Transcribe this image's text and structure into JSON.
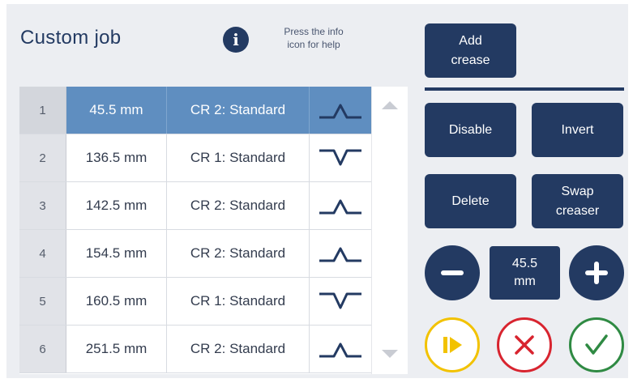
{
  "header": {
    "title": "Custom job",
    "info_text_line1": "Press the info",
    "info_text_line2": "icon for help"
  },
  "buttons": {
    "add_line1": "Add",
    "add_line2": "crease",
    "disable": "Disable",
    "invert": "Invert",
    "delete": "Delete",
    "swap_line1": "Swap",
    "swap_line2": "creaser"
  },
  "adjust": {
    "value": "45.5",
    "unit": "mm"
  },
  "creases": [
    {
      "num": "1",
      "position": "45.5 mm",
      "creaser": "CR 2: Standard",
      "shape": "up",
      "selected": true
    },
    {
      "num": "2",
      "position": "136.5 mm",
      "creaser": "CR 1: Standard",
      "shape": "down",
      "selected": false
    },
    {
      "num": "3",
      "position": "142.5 mm",
      "creaser": "CR 2: Standard",
      "shape": "up",
      "selected": false
    },
    {
      "num": "4",
      "position": "154.5 mm",
      "creaser": "CR 2: Standard",
      "shape": "up",
      "selected": false
    },
    {
      "num": "5",
      "position": "160.5 mm",
      "creaser": "CR 1: Standard",
      "shape": "down",
      "selected": false
    },
    {
      "num": "6",
      "position": "251.5 mm",
      "creaser": "CR 2: Standard",
      "shape": "up",
      "selected": false
    }
  ],
  "colors": {
    "navy": "#233a62",
    "selected_row": "#5f8ec0",
    "play": "#f2c200",
    "cancel": "#d8242f",
    "confirm": "#2f8a43"
  }
}
